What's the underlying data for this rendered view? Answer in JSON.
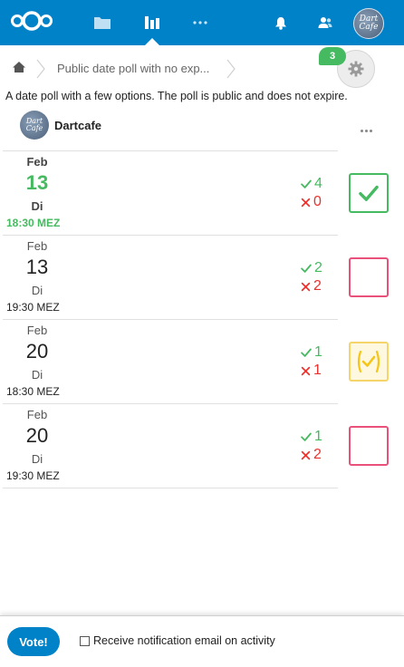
{
  "header": {
    "nav": [
      {
        "id": "files",
        "icon": "folder-icon"
      },
      {
        "id": "polls",
        "icon": "poll-icon",
        "active": true
      },
      {
        "id": "more-apps",
        "icon": "more-apps-icon"
      }
    ],
    "notifications_icon": "bell-icon",
    "contacts_icon": "contacts-icon",
    "avatar_text_1": "Dart",
    "avatar_text_2": "Cafe",
    "brand_color": "#0082c9"
  },
  "breadcrumb": {
    "home_icon": "home-icon",
    "current": "Public date poll with no exp..."
  },
  "settings": {
    "badge_count": "3",
    "icon": "gear-icon"
  },
  "poll": {
    "description": "A date poll with a few options. The poll is public and does not expire.",
    "owner": {
      "name": "Dartcafe",
      "avatar_text_1": "Dart",
      "avatar_text_2": "Cafe"
    }
  },
  "options": [
    {
      "month": "Feb",
      "day": "13",
      "dow": "Di",
      "time": "18:30 MEZ",
      "yes": "4",
      "no": "0",
      "vote": "yes",
      "winner": true
    },
    {
      "month": "Feb",
      "day": "13",
      "dow": "Di",
      "time": "19:30 MEZ",
      "yes": "2",
      "no": "2",
      "vote": "no",
      "winner": false
    },
    {
      "month": "Feb",
      "day": "20",
      "dow": "Di",
      "time": "18:30 MEZ",
      "yes": "1",
      "no": "1",
      "vote": "maybe",
      "winner": false
    },
    {
      "month": "Feb",
      "day": "20",
      "dow": "Di",
      "time": "19:30 MEZ",
      "yes": "1",
      "no": "2",
      "vote": "no",
      "winner": false
    }
  ],
  "footer": {
    "vote_label": "Vote!",
    "notify_label": "Receive notification email on activity",
    "notify_checked": false
  },
  "colors": {
    "yes": "#46ba61",
    "no": "#e9322d",
    "maybe": "#f5c518"
  }
}
